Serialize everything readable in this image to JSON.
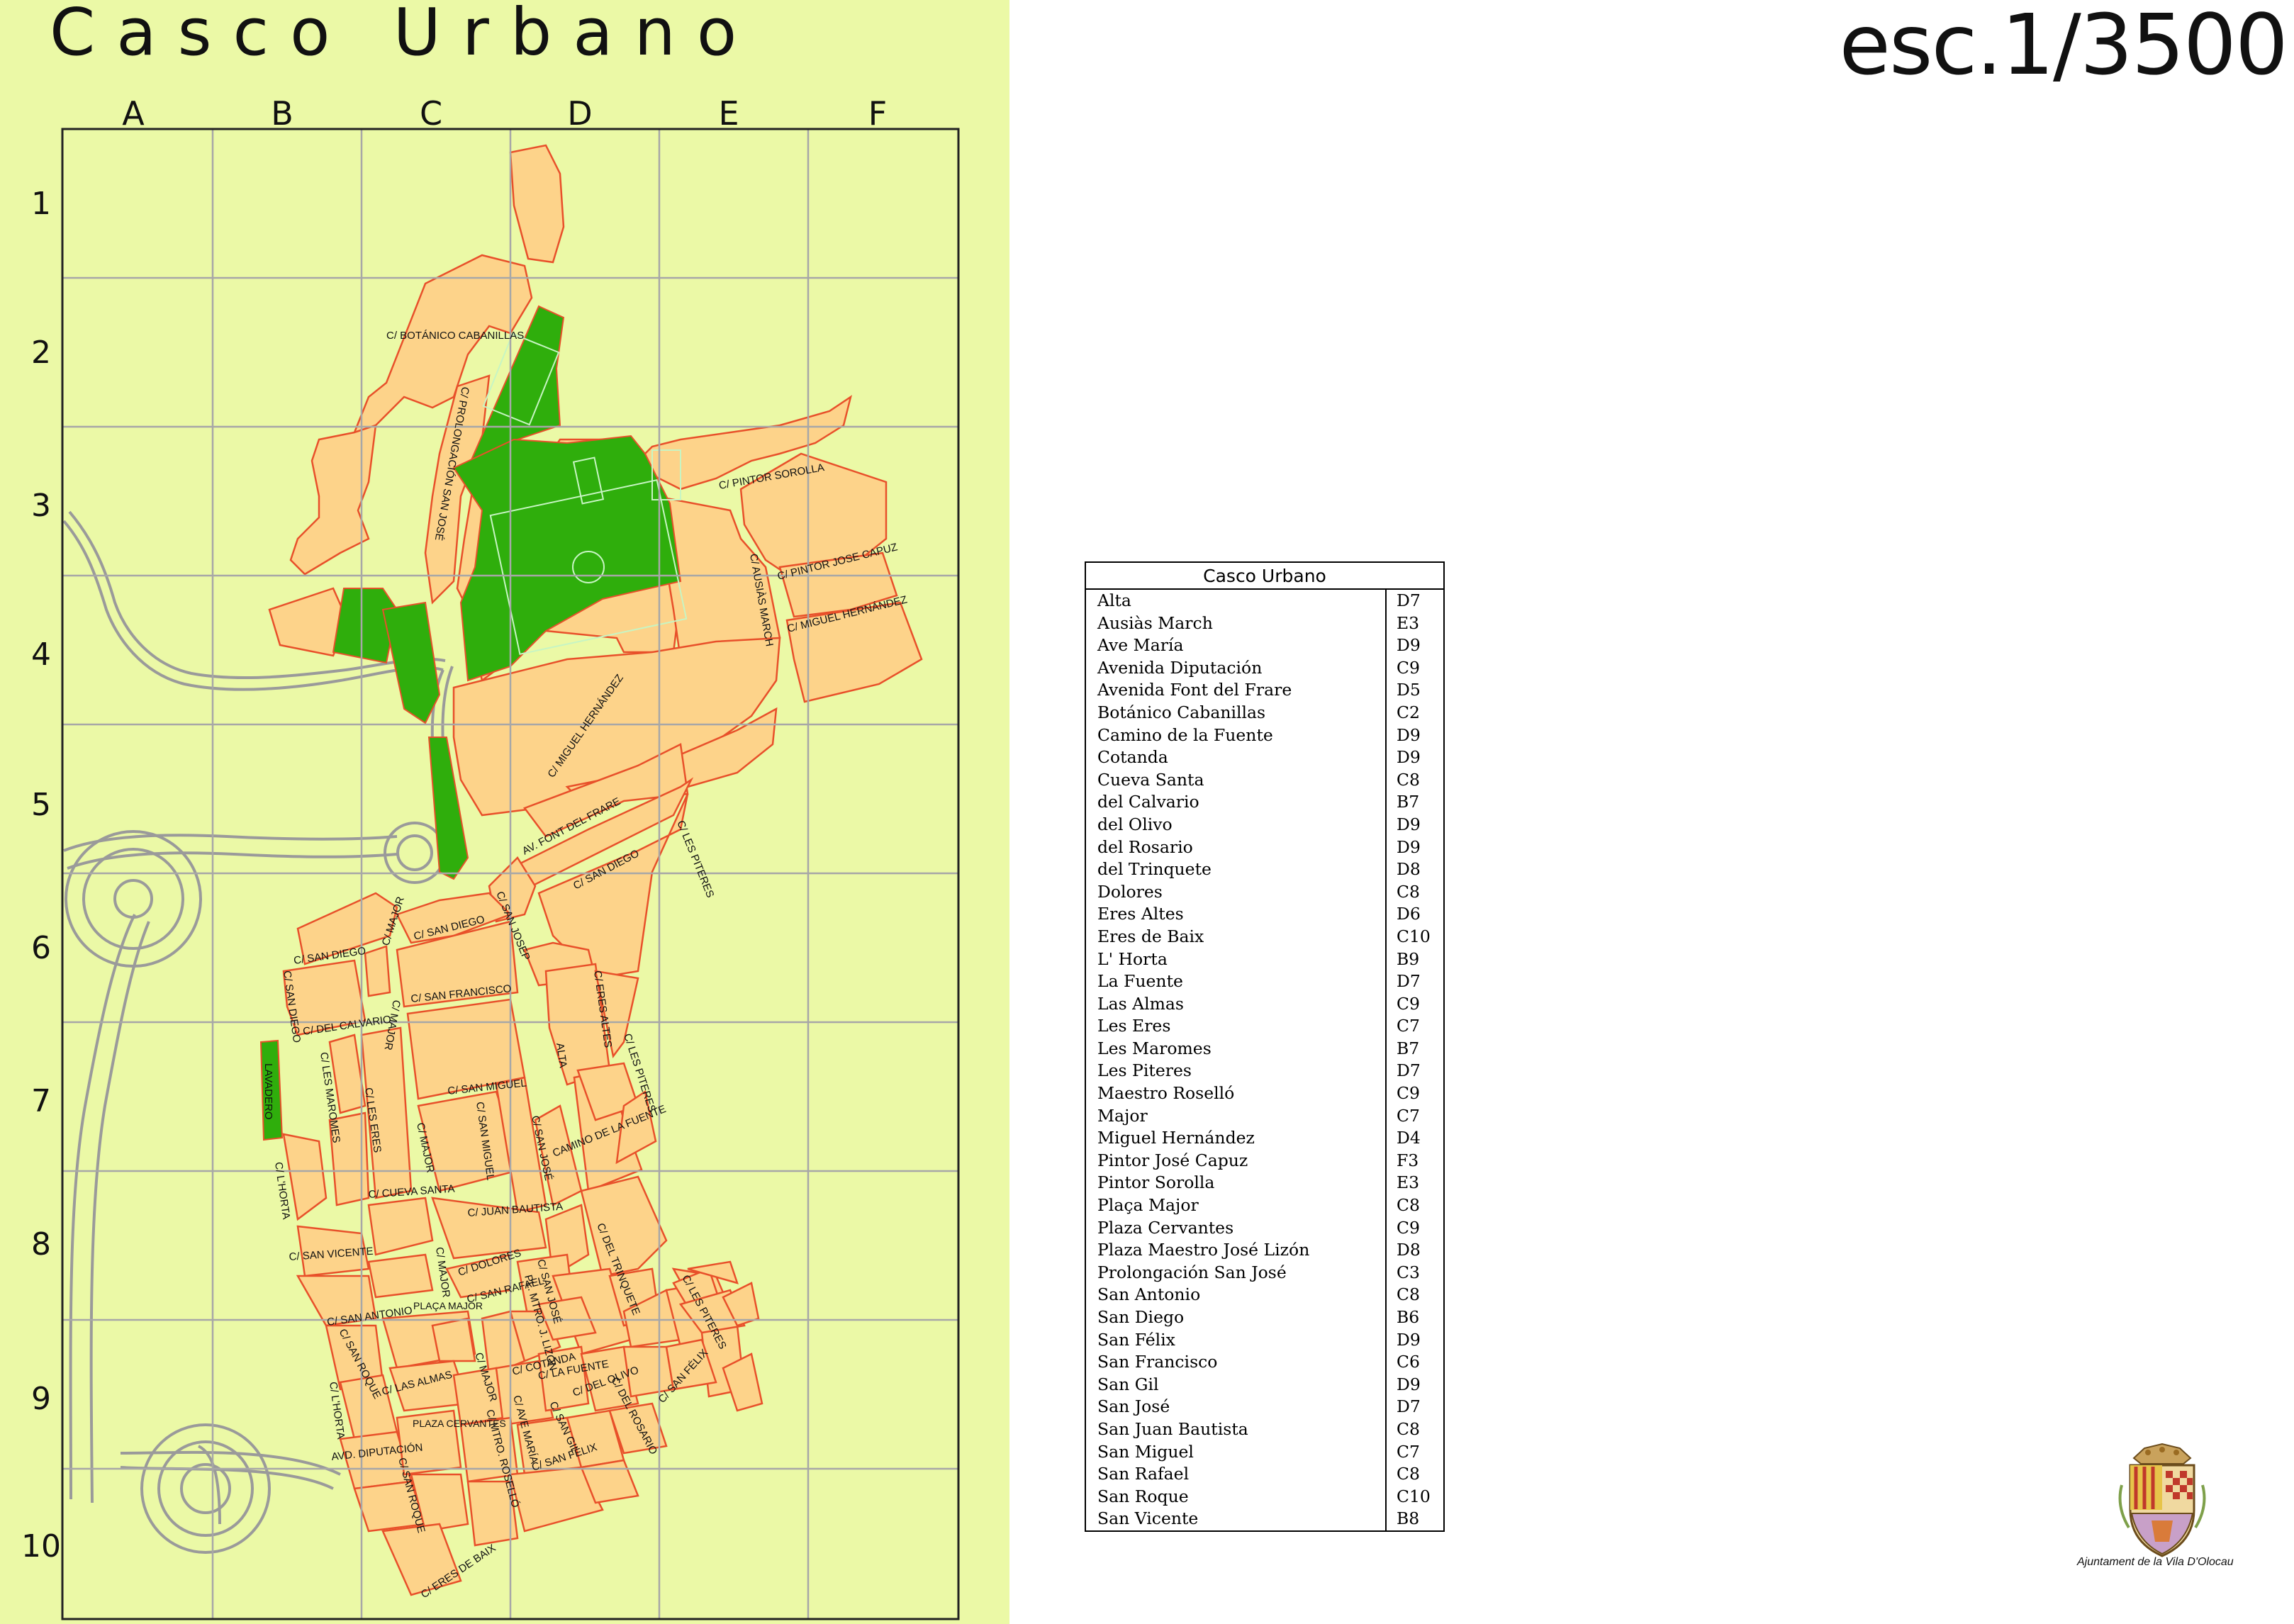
{
  "title": "Casco Urbano",
  "scale": "esc.1/3500",
  "grid": {
    "columns": [
      "A",
      "B",
      "C",
      "D",
      "E",
      "F"
    ],
    "rows": [
      "1",
      "2",
      "3",
      "4",
      "5",
      "6",
      "7",
      "8",
      "9",
      "10"
    ]
  },
  "colors": {
    "map_background": "#ebf9a6",
    "block_fill": "#fdd38a",
    "block_stroke": "#e8502a",
    "green_area": "#2fae0c",
    "grid_line": "#a7a7a7",
    "road_line": "#9a9a9a"
  },
  "map_labels": [
    "C/ BOTÁNICO CABANILLAS",
    "C/ PROLONGACIÓN SAN JOSÉ",
    "C/ PINTOR SOROLLA",
    "C/ AUSIÀS MARCH",
    "C/ PINTOR JOSE CAPUZ",
    "C/ MIGUEL HERNÁNDEZ",
    "C/ MIGUEL HERNÁNDEZ",
    "AV. FONT DEL FRARE",
    "C/ LES PITERES",
    "C/ SAN DIEGO",
    "C/ SAN DIEGO",
    "C/ SAN DIEGO",
    "C/ SAN DIEGO",
    "C/ MAJOR",
    "C/ SAN JOSEP",
    "C/ SAN FRANCISCO",
    "C/ MAJOR",
    "C/ ERES ALTES",
    "C/ DEL CALVARIO",
    "C/ LES MAROMES",
    "LAVADERO",
    "C/ LES PITERES",
    "ALTA",
    "C/ LES ERES",
    "C/ SAN MIGUEL",
    "C/ SAN MIGUEL",
    "C/ MAJOR",
    "C/ SAN JOSÉ",
    "CAMINO DE LA FUENTE",
    "C/ L'HORTA",
    "C/ CUEVA SANTA",
    "C/ JUAN BAUTISTA",
    "C/ DEL TRINQUETE",
    "C/ SAN VICENTE",
    "C/ MAJOR",
    "C/ DOLORES",
    "C/ LES PITERES",
    "C/ SAN ANTONIO",
    "PLAÇA MAJOR",
    "C/ SAN RAFAEL",
    "C/ SAN JOSÉ",
    "PL. MTRO. J. LIZÓN",
    "C/ SAN ROQUE",
    "C/ LAS ALMAS",
    "C/ MAJOR",
    "C/ COTANDA",
    "C/ LA FUENTE",
    "C/ DEL OLIVO",
    "C/ DEL ROSARIO",
    "C/ SAN FÉLIX",
    "C/ L'HORTA",
    "AVD. DIPUTACIÓN",
    "PLAZA CERVANTES",
    "C/ MTRO. ROSELLÓ",
    "C/ AVE MARÍA",
    "C/ SAN GIL",
    "C/ SAN FÉLIX",
    "C/ SAN ROQUE",
    "C/ ERES DE BAIX"
  ],
  "index": {
    "header": "Casco Urbano",
    "entries": [
      {
        "name": "Alta",
        "grid": "D7"
      },
      {
        "name": "Ausiàs March",
        "grid": "E3"
      },
      {
        "name": "Ave María",
        "grid": "D9"
      },
      {
        "name": "Avenida Diputación",
        "grid": "C9"
      },
      {
        "name": "Avenida Font del Frare",
        "grid": "D5"
      },
      {
        "name": "Botánico Cabanillas",
        "grid": "C2"
      },
      {
        "name": "Camino de la Fuente",
        "grid": "D9"
      },
      {
        "name": "Cotanda",
        "grid": "D9"
      },
      {
        "name": "Cueva Santa",
        "grid": "C8"
      },
      {
        "name": "del Calvario",
        "grid": "B7"
      },
      {
        "name": "del Olivo",
        "grid": "D9"
      },
      {
        "name": "del Rosario",
        "grid": "D9"
      },
      {
        "name": "del Trinquete",
        "grid": "D8"
      },
      {
        "name": "Dolores",
        "grid": "C8"
      },
      {
        "name": "Eres Altes",
        "grid": "D6"
      },
      {
        "name": "Eres de Baix",
        "grid": "C10"
      },
      {
        "name": "L' Horta",
        "grid": "B9"
      },
      {
        "name": "La Fuente",
        "grid": "D7"
      },
      {
        "name": "Las Almas",
        "grid": "C9"
      },
      {
        "name": "Les Eres",
        "grid": "C7"
      },
      {
        "name": "Les Maromes",
        "grid": "B7"
      },
      {
        "name": "Les Piteres",
        "grid": "D7"
      },
      {
        "name": "Maestro Roselló",
        "grid": "C9"
      },
      {
        "name": "Major",
        "grid": "C7"
      },
      {
        "name": "Miguel Hernández",
        "grid": "D4"
      },
      {
        "name": "Pintor José Capuz",
        "grid": "F3"
      },
      {
        "name": "Pintor Sorolla",
        "grid": "E3"
      },
      {
        "name": "Plaça Major",
        "grid": "C8"
      },
      {
        "name": "Plaza Cervantes",
        "grid": "C9"
      },
      {
        "name": "Plaza Maestro José Lizón",
        "grid": "D8"
      },
      {
        "name": "Prolongación San José",
        "grid": "C3"
      },
      {
        "name": "San Antonio",
        "grid": "C8"
      },
      {
        "name": "San Diego",
        "grid": "B6"
      },
      {
        "name": "San Félix",
        "grid": "D9"
      },
      {
        "name": "San Francisco",
        "grid": "C6"
      },
      {
        "name": "San Gil",
        "grid": "D9"
      },
      {
        "name": "San José",
        "grid": "D7"
      },
      {
        "name": "San Juan Bautista",
        "grid": "C8"
      },
      {
        "name": "San Miguel",
        "grid": "C7"
      },
      {
        "name": "San Rafael",
        "grid": "C8"
      },
      {
        "name": "San Roque",
        "grid": "C10"
      },
      {
        "name": "San Vicente",
        "grid": "B8"
      }
    ]
  },
  "crest_caption": "Ajuntament de la Vila D'Olocau"
}
